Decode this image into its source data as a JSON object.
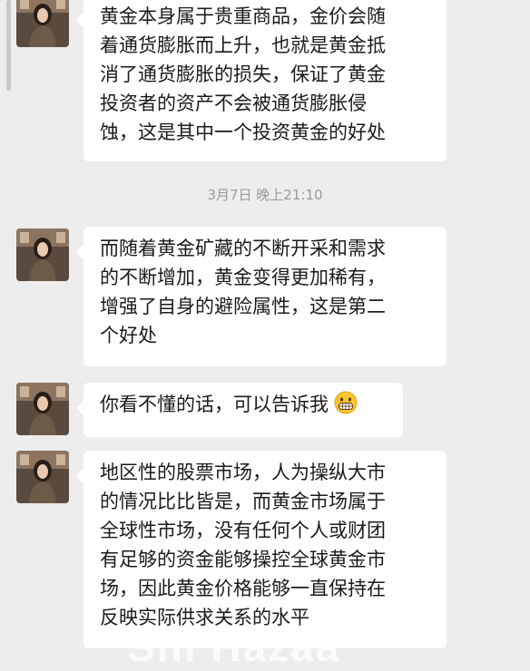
{
  "messages": [
    {
      "lines": [
        "黄金本身属于贵重商品，金价会随",
        "着通货膨胀而上升，也就是黄金抵",
        "消了通货膨胀的损失，保证了黄金",
        "投资者的资产不会被通货膨胀侵",
        "蚀，这是其中一个投资黄金的好处"
      ]
    },
    {
      "lines": [
        "而随着黄金矿藏的不断开采和需求",
        "的不断增加，黄金变得更加稀有，",
        "增强了自身的避险属性，这是第二",
        "个好处"
      ]
    },
    {
      "lines": [
        "你看不懂的话，可以告诉我"
      ],
      "emoji": "grinning-face-emoji"
    },
    {
      "lines": [
        "地区性的股票市场，人为操纵大市",
        "的情况比比皆是，而黄金市场属于",
        "全球性市场，没有任何个人或财团",
        "有足够的资金能够操控全球黄金市",
        "场，因此黄金价格能够一直保持在",
        "反映实际供求关系的水平"
      ]
    }
  ],
  "timestamp": "3月7日 晚上21:10",
  "watermark": "Shi Hazaa"
}
